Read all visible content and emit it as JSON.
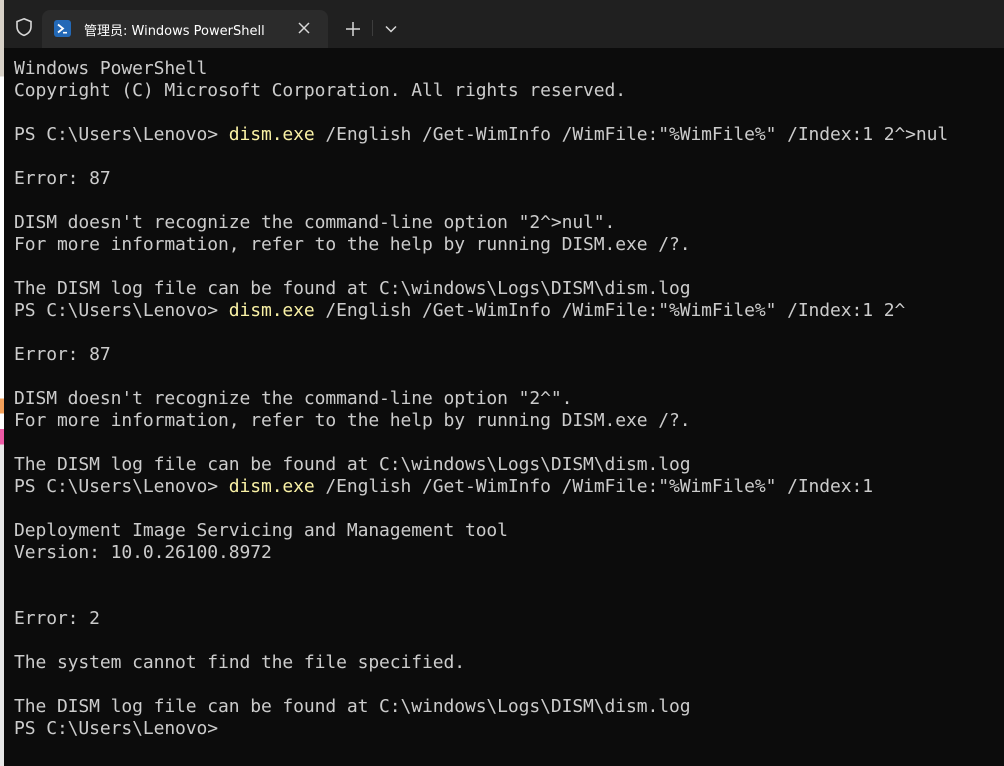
{
  "titlebar": {
    "tab_title": "管理员: Windows PowerShell",
    "icons": {
      "shield": "shield-icon",
      "tab_app": "powershell-icon",
      "tab_close": "close-icon",
      "new_tab": "plus-icon",
      "dropdown": "chevron-down-icon"
    }
  },
  "colors": {
    "background": "#0c0c0c",
    "titlebar": "#202020",
    "tab_active": "#2b2b2b",
    "text": "#cccccc",
    "command": "#f9f1a5",
    "ps_icon": "#2369b7"
  },
  "terminal": {
    "lines": [
      {
        "text": "Windows PowerShell"
      },
      {
        "text": "Copyright (C) Microsoft Corporation. All rights reserved."
      },
      {
        "text": ""
      },
      {
        "prompt": "PS C:\\Users\\Lenovo> ",
        "cmd": "dism.exe",
        "args": " /English /Get-WimInfo /WimFile:\"%WimFile%\" /Index:1 2^>nul"
      },
      {
        "text": ""
      },
      {
        "text": "Error: 87"
      },
      {
        "text": ""
      },
      {
        "text": "DISM doesn't recognize the command-line option \"2^>nul\"."
      },
      {
        "text": "For more information, refer to the help by running DISM.exe /?."
      },
      {
        "text": ""
      },
      {
        "text": "The DISM log file can be found at C:\\windows\\Logs\\DISM\\dism.log"
      },
      {
        "prompt": "PS C:\\Users\\Lenovo> ",
        "cmd": "dism.exe",
        "args": " /English /Get-WimInfo /WimFile:\"%WimFile%\" /Index:1 2^"
      },
      {
        "text": ""
      },
      {
        "text": "Error: 87"
      },
      {
        "text": ""
      },
      {
        "text": "DISM doesn't recognize the command-line option \"2^\"."
      },
      {
        "text": "For more information, refer to the help by running DISM.exe /?."
      },
      {
        "text": ""
      },
      {
        "text": "The DISM log file can be found at C:\\windows\\Logs\\DISM\\dism.log"
      },
      {
        "prompt": "PS C:\\Users\\Lenovo> ",
        "cmd": "dism.exe",
        "args": " /English /Get-WimInfo /WimFile:\"%WimFile%\" /Index:1"
      },
      {
        "text": ""
      },
      {
        "text": "Deployment Image Servicing and Management tool"
      },
      {
        "text": "Version: 10.0.26100.8972"
      },
      {
        "text": ""
      },
      {
        "text": ""
      },
      {
        "text": "Error: 2"
      },
      {
        "text": ""
      },
      {
        "text": "The system cannot find the file specified."
      },
      {
        "text": ""
      },
      {
        "text": "The DISM log file can be found at C:\\windows\\Logs\\DISM\\dism.log"
      },
      {
        "prompt": "PS C:\\Users\\Lenovo> ",
        "cmd": "",
        "args": ""
      }
    ]
  }
}
